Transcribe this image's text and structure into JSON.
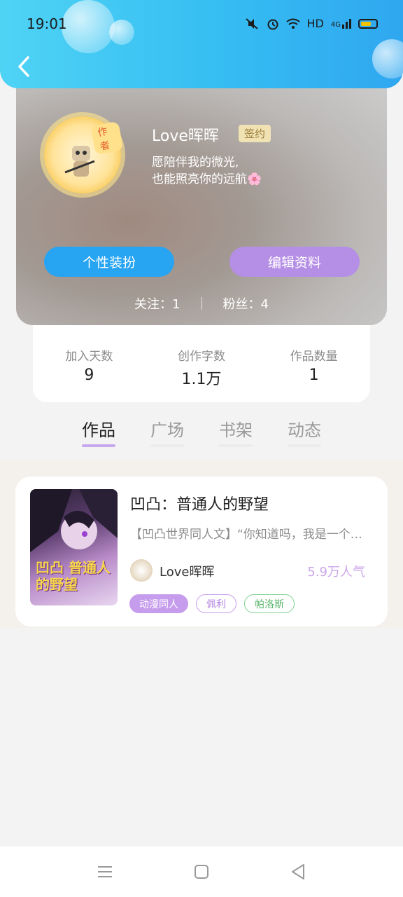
{
  "status_bar": {
    "time": "19:01",
    "icons": [
      "mute-icon",
      "alarm-icon",
      "wifi-icon",
      "hd-icon",
      "4g-signal-icon",
      "battery-icon"
    ],
    "hd_label": "HD",
    "network_label": "4G"
  },
  "header": {
    "back_icon": "back-chevron-icon",
    "accent_color": "#36bdf2"
  },
  "profile": {
    "avatar_tag": "作者",
    "username": "Love晖晖",
    "sign_badge": "签约",
    "motto_line1": "愿陪伴我的微光,",
    "motto_line2": "也能照亮你的远航🌸",
    "dress_button": "个性装扮",
    "edit_button": "编辑资料",
    "follow_label": "关注：1",
    "fans_label": "粉丝：4"
  },
  "stats": [
    {
      "label": "加入天数",
      "value": "9"
    },
    {
      "label": "创作字数",
      "value": "1.1万"
    },
    {
      "label": "作品数量",
      "value": "1"
    }
  ],
  "tabs": [
    {
      "label": "作品",
      "active": true
    },
    {
      "label": "广场",
      "active": false
    },
    {
      "label": "书架",
      "active": false
    },
    {
      "label": "动态",
      "active": false
    }
  ],
  "book": {
    "cover_text": "凹凸 普通人的野望",
    "title": "凹凸：普通人的野望",
    "description": "【凹凸世界同人文】“你知道吗，我是一个…",
    "author": "Love晖晖",
    "popularity": "5.9万人气",
    "tags": [
      "动漫同人",
      "佩利",
      "帕洛斯"
    ]
  },
  "bottom_nav": [
    "menu-icon",
    "home-square-icon",
    "back-triangle-icon"
  ]
}
